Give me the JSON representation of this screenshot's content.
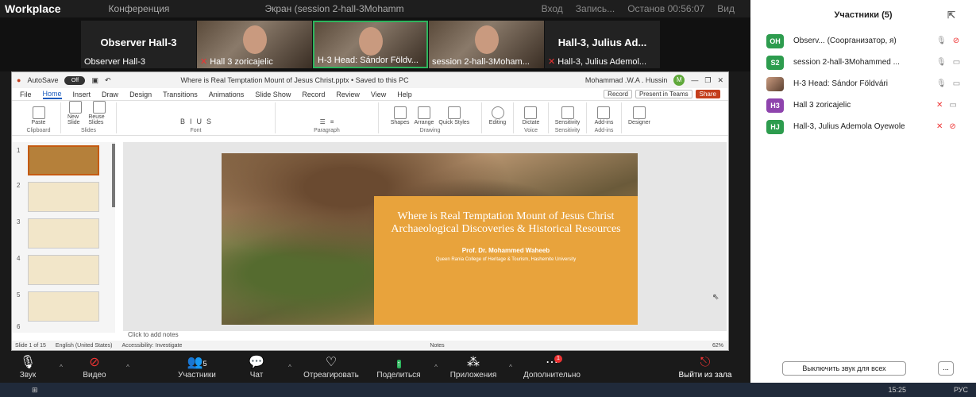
{
  "topbar": {
    "workspace": "Workplace",
    "conference": "Конференция",
    "screen_title": "Экран (session 2-hall-3Mohamm",
    "right": [
      "Вход",
      "Запись...",
      "Останов 00:56:07",
      "Вид"
    ]
  },
  "thumbs": [
    {
      "big": "Observer  Hall-3",
      "caption": "Observer  Hall-3",
      "video": false,
      "muted": false
    },
    {
      "caption": "Hall 3 zoricajelic",
      "video": true,
      "muted": true
    },
    {
      "caption": "H-3 Head: Sándor Földv...",
      "video": true,
      "muted": false
    },
    {
      "caption": "session 2-hall-3Moham...",
      "video": true,
      "muted": false
    },
    {
      "big": "Hall-3, Julius Ad...",
      "caption": "Hall-3, Julius Ademol...",
      "video": false,
      "muted": true
    }
  ],
  "ppt": {
    "autosave": "AutoSave",
    "toggle": "Off",
    "filename": "Where is Real Temptation Mount of Jesus Christ.pptx • Saved to this PC",
    "user": "Mohammad .W.A . Hussin",
    "user_initial": "M",
    "menu": [
      "File",
      "Home",
      "Insert",
      "Draw",
      "Design",
      "Transitions",
      "Animations",
      "Slide Show",
      "Record",
      "Review",
      "View",
      "Help"
    ],
    "record_btn": "Record",
    "present_btn": "Present in Teams",
    "share_btn": "Share",
    "ribbon_groups": [
      {
        "label": "Clipboard",
        "items": [
          "Paste"
        ]
      },
      {
        "label": "Slides",
        "items": [
          "New Slide",
          "Reuse Slides"
        ]
      },
      {
        "label": "Font",
        "items": []
      },
      {
        "label": "Paragraph",
        "items": []
      },
      {
        "label": "Drawing",
        "items": [
          "Shapes",
          "Arrange",
          "Quick Styles"
        ]
      },
      {
        "label": "",
        "items": [
          "Editing"
        ]
      },
      {
        "label": "Voice",
        "items": [
          "Dictate"
        ]
      },
      {
        "label": "Sensitivity",
        "items": [
          "Sensitivity"
        ]
      },
      {
        "label": "Add-ins",
        "items": [
          "Add-ins"
        ]
      },
      {
        "label": "",
        "items": [
          "Designer"
        ]
      }
    ],
    "slide_numbers": [
      "1",
      "2",
      "3",
      "4",
      "5",
      "6"
    ],
    "slide": {
      "title": "Where is Real Temptation Mount of Jesus Christ Archaeological Discoveries & Historical Resources",
      "author": "Prof. Dr. Mohammed Waheeb",
      "affiliation": "Queen Rania College of Heritage & Tourism, Hashemite University"
    },
    "notes_placeholder": "Click to add notes",
    "status": {
      "slide_of": "Slide 1 of 15",
      "language": "English (United States)",
      "accessibility": "Accessibility: Investigate",
      "notes": "Notes",
      "zoom": "62%"
    }
  },
  "controls": {
    "audio": "Звук",
    "video": "Видео",
    "participants": "Участники",
    "participants_count": "5",
    "chat": "Чат",
    "react": "Отреагировать",
    "share": "Поделиться",
    "apps": "Приложения",
    "more": "Дополнительно",
    "more_badge": "1",
    "leave": "Выйти из зала"
  },
  "panel": {
    "title": "Участники (5)",
    "participants": [
      {
        "initials": "OH",
        "color": "#2d9c4e",
        "name": "Observ...  (Соорганизатор, я)",
        "mic_muted": false,
        "video_off": true
      },
      {
        "initials": "S2",
        "color": "#2d9c4e",
        "name": "session 2-hall-3Mohammed ...",
        "mic_muted": false,
        "video_off": false
      },
      {
        "initials": "",
        "color": "",
        "name": "H-3 Head: Sándor Földvári",
        "mic_muted": false,
        "video_off": false
      },
      {
        "initials": "H3",
        "color": "#8e44ad",
        "name": "Hall 3 zoricajelic",
        "mic_muted": true,
        "video_off": false
      },
      {
        "initials": "HJ",
        "color": "#2d9c4e",
        "name": "Hall-3, Julius Ademola Oyewole",
        "mic_muted": true,
        "video_off": true
      }
    ],
    "mute_all": "Выключить звук для всех",
    "more": "..."
  },
  "taskbar": {
    "time": "15:25",
    "lang": "РУС"
  }
}
